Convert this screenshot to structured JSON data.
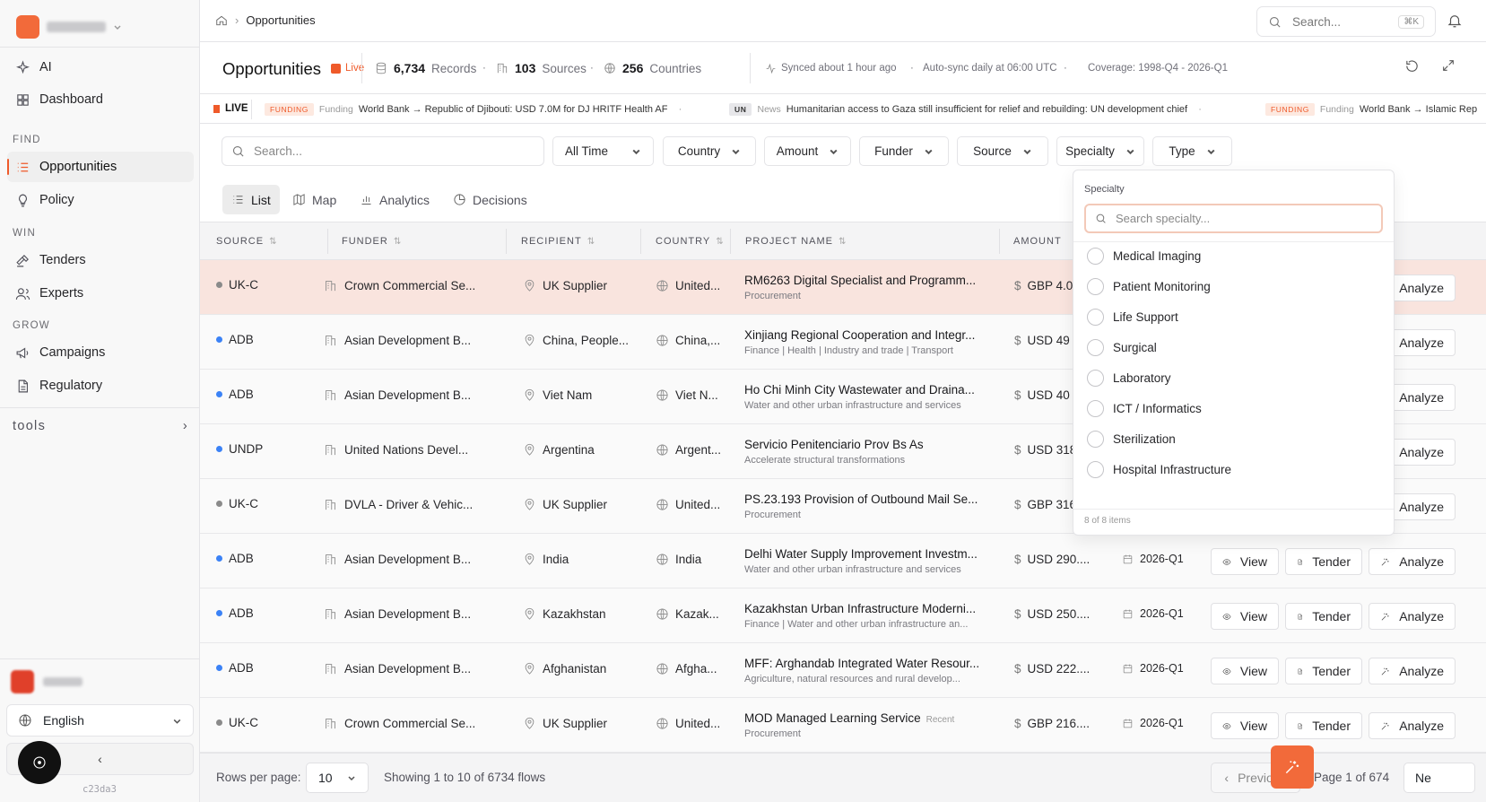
{
  "workspace": {
    "name": ""
  },
  "sidebar": {
    "items_top": [
      {
        "label": "AI",
        "icon": "sparkle-icon"
      },
      {
        "label": "Dashboard",
        "icon": "grid-icon"
      }
    ],
    "find_label": "FIND",
    "find_items": [
      {
        "label": "Opportunities",
        "icon": "list-icon"
      },
      {
        "label": "Policy",
        "icon": "bulb-icon"
      }
    ],
    "win_label": "WIN",
    "win_items": [
      {
        "label": "Tenders",
        "icon": "hammer-icon"
      },
      {
        "label": "Experts",
        "icon": "users-icon"
      }
    ],
    "grow_label": "GROW",
    "grow_items": [
      {
        "label": "Campaigns",
        "icon": "megaphone-icon"
      },
      {
        "label": "Regulatory",
        "icon": "file-icon"
      }
    ],
    "tools_label": "tools",
    "language": "English",
    "version": "c23da3"
  },
  "breadcrumb": {
    "current": "Opportunities"
  },
  "global_search": {
    "placeholder": "Search...",
    "shortcut": "⌘K"
  },
  "title_bar": {
    "title": "Opportunities",
    "live": "Live",
    "records_value": "6,734",
    "records_label": "Records",
    "sources_value": "103",
    "sources_label": "Sources",
    "countries_value": "256",
    "countries_label": "Countries",
    "synced": "Synced about 1 hour ago",
    "autosync": "Auto-sync daily at 06:00 UTC",
    "coverage": "Coverage: 1998-Q4 - 2026-Q1"
  },
  "ticker": {
    "live_label": "LIVE",
    "items": [
      {
        "tag": "FUNDING",
        "kind": "Funding",
        "text": "World Bank → Republic of Djibouti: USD 7.0M for DJ HRITF Health AF"
      },
      {
        "tag": "UN",
        "kind": "News",
        "text": "Humanitarian access to Gaza still insufficient for relief and rebuilding: UN development chief"
      },
      {
        "tag": "FUNDING",
        "kind": "Funding",
        "text": "World Bank → Islamic Rep"
      }
    ]
  },
  "filters": {
    "search_placeholder": "Search...",
    "time": "All Time",
    "buttons": [
      "Country",
      "Amount",
      "Funder",
      "Source",
      "Specialty",
      "Type"
    ]
  },
  "view_tabs": [
    "List",
    "Map",
    "Analytics",
    "Decisions"
  ],
  "table": {
    "headers": [
      "SOURCE",
      "FUNDER",
      "RECIPIENT",
      "COUNTRY",
      "PROJECT NAME",
      "AMOUNT"
    ],
    "rows": [
      {
        "source": "UK-C",
        "dot": "#8a8a8a",
        "funder": "Crown Commercial Se...",
        "recipient": "UK Supplier",
        "country": "United...",
        "name": "RM6263 Digital Specialist and Programm...",
        "sub": "Procurement",
        "recent": "",
        "amount": "GBP 4.0",
        "period": ""
      },
      {
        "source": "ADB",
        "dot": "#3b82f6",
        "funder": "Asian Development B...",
        "recipient": "China, People...",
        "country": "China,...",
        "name": "Xinjiang Regional Cooperation and Integr...",
        "sub": "Finance | Health | Industry and trade | Transport",
        "recent": "",
        "amount": "USD 49",
        "period": ""
      },
      {
        "source": "ADB",
        "dot": "#3b82f6",
        "funder": "Asian Development B...",
        "recipient": "Viet Nam",
        "country": "Viet N...",
        "name": "Ho Chi Minh City Wastewater and Draina...",
        "sub": "Water and other urban infrastructure and services",
        "recent": "",
        "amount": "USD 40",
        "period": ""
      },
      {
        "source": "UNDP",
        "dot": "#3b82f6",
        "funder": "United Nations Devel...",
        "recipient": "Argentina",
        "country": "Argent...",
        "name": "Servicio Penitenciario Prov Bs As",
        "sub": "Accelerate structural transformations",
        "recent": "",
        "amount": "USD 318",
        "period": ""
      },
      {
        "source": "UK-C",
        "dot": "#8a8a8a",
        "funder": "DVLA - Driver & Vehic...",
        "recipient": "UK Supplier",
        "country": "United...",
        "name": "PS.23.193 Provision of Outbound Mail Se...",
        "sub": "Procurement",
        "recent": "",
        "amount": "GBP 316",
        "period": ""
      },
      {
        "source": "ADB",
        "dot": "#3b82f6",
        "funder": "Asian Development B...",
        "recipient": "India",
        "country": "India",
        "name": "Delhi Water Supply Improvement Investm...",
        "sub": "Water and other urban infrastructure and services",
        "recent": "",
        "amount": "USD 290....",
        "period": "2026-Q1"
      },
      {
        "source": "ADB",
        "dot": "#3b82f6",
        "funder": "Asian Development B...",
        "recipient": "Kazakhstan",
        "country": "Kazak...",
        "name": "Kazakhstan Urban Infrastructure Moderni...",
        "sub": "Finance | Water and other urban infrastructure an...",
        "recent": "",
        "amount": "USD 250....",
        "period": "2026-Q1"
      },
      {
        "source": "ADB",
        "dot": "#3b82f6",
        "funder": "Asian Development B...",
        "recipient": "Afghanistan",
        "country": "Afgha...",
        "name": "MFF: Arghandab Integrated Water Resour...",
        "sub": "Agriculture, natural resources and rural develop...",
        "recent": "",
        "amount": "USD 222....",
        "period": "2026-Q1"
      },
      {
        "source": "UK-C",
        "dot": "#8a8a8a",
        "funder": "Crown Commercial Se...",
        "recipient": "UK Supplier",
        "country": "United...",
        "name": "MOD Managed Learning Service",
        "sub": "Procurement",
        "recent": "Recent",
        "amount": "GBP 216....",
        "period": "2026-Q1"
      }
    ],
    "actions": {
      "view": "View",
      "tender": "Tender",
      "analyze": "Analyze"
    }
  },
  "footer": {
    "rows_per_page_label": "Rows per page:",
    "rows_per_page": "10",
    "showing": "Showing 1 to 10 of 6734 flows",
    "previous": "Previous",
    "page": "Page 1 of 674",
    "next": "Ne"
  },
  "specialty_dropdown": {
    "title": "Specialty",
    "placeholder": "Search specialty...",
    "options": [
      "Medical Imaging",
      "Patient Monitoring",
      "Life Support",
      "Surgical",
      "Laboratory",
      "ICT / Informatics",
      "Sterilization",
      "Hospital Infrastructure"
    ],
    "count": "8 of 8 items"
  },
  "colors": {
    "accent": "#ef5a2a",
    "highlight_row": "#f9e4de"
  }
}
